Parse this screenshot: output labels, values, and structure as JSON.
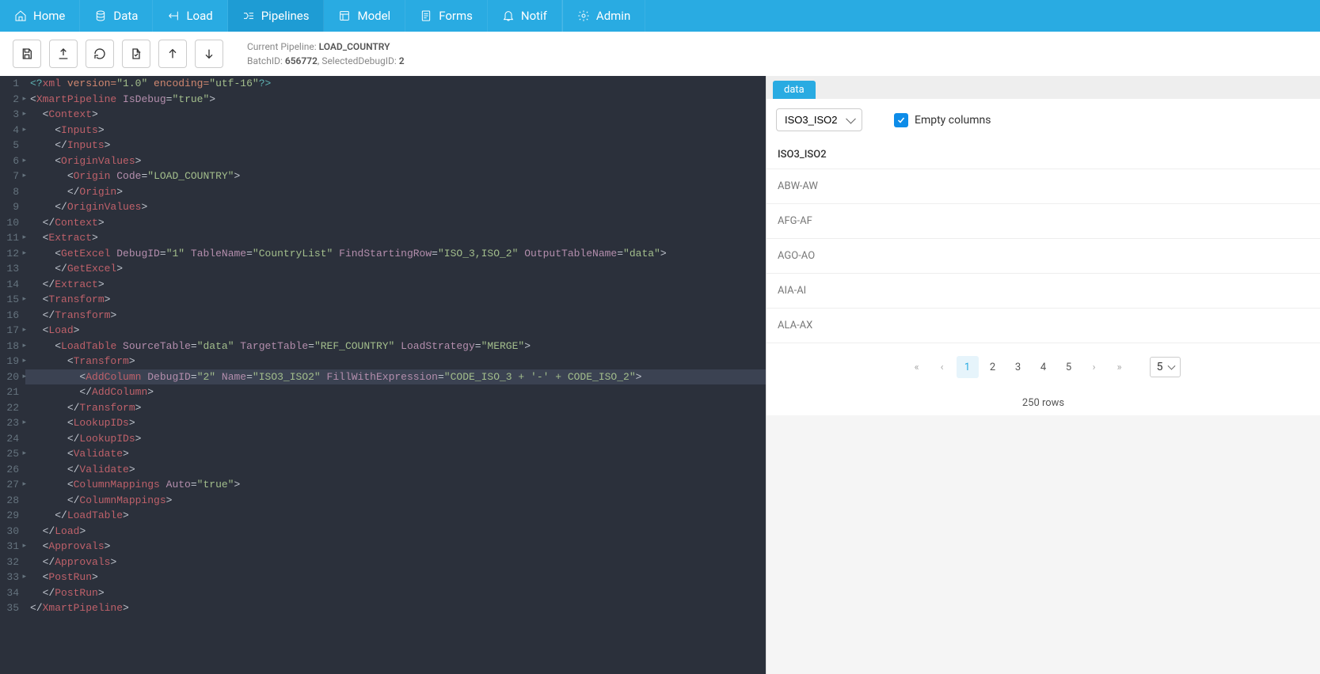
{
  "nav": [
    {
      "label": "Home",
      "icon": "home"
    },
    {
      "label": "Data",
      "icon": "db"
    },
    {
      "label": "Load",
      "icon": "load"
    },
    {
      "label": "Pipelines",
      "icon": "pipe",
      "active": true
    },
    {
      "label": "Model",
      "icon": "model"
    },
    {
      "label": "Forms",
      "icon": "forms"
    },
    {
      "label": "Notif",
      "icon": "bell"
    },
    {
      "label": "Admin",
      "icon": "gear",
      "sep": true
    }
  ],
  "info": {
    "pipeline_label": "Current Pipeline: ",
    "pipeline_name": "LOAD_COUNTRY",
    "batch_label": "BatchID: ",
    "batch_id": "656772",
    "debug_label": ", SelectedDebugID: ",
    "debug_id": "2"
  },
  "code": {
    "highlight_line": 20,
    "lines": [
      {
        "n": 1,
        "fold": false,
        "tokens": [
          [
            "<?",
            "pi"
          ],
          [
            "xml",
            "tag"
          ],
          [
            " version=",
            "attr"
          ],
          [
            "\"1.0\"",
            "str"
          ],
          [
            " encoding=",
            "attr"
          ],
          [
            "\"utf-16\"",
            "str"
          ],
          [
            "?>",
            "pi"
          ]
        ]
      },
      {
        "n": 2,
        "fold": true,
        "tokens": [
          [
            "<",
            "punct"
          ],
          [
            "XmartPipeline",
            "tag"
          ],
          [
            " IsDebug",
            "attr2"
          ],
          [
            "=",
            "punct"
          ],
          [
            "\"true\"",
            "str"
          ],
          [
            ">",
            "punct"
          ]
        ]
      },
      {
        "n": 3,
        "fold": true,
        "indent": 1,
        "tokens": [
          [
            "<",
            "punct"
          ],
          [
            "Context",
            "tag"
          ],
          [
            ">",
            "punct"
          ]
        ]
      },
      {
        "n": 4,
        "fold": true,
        "indent": 2,
        "tokens": [
          [
            "<",
            "punct"
          ],
          [
            "Inputs",
            "tag"
          ],
          [
            ">",
            "punct"
          ]
        ]
      },
      {
        "n": 5,
        "indent": 2,
        "tokens": [
          [
            "</",
            "punct"
          ],
          [
            "Inputs",
            "tag"
          ],
          [
            ">",
            "punct"
          ]
        ]
      },
      {
        "n": 6,
        "fold": true,
        "indent": 2,
        "tokens": [
          [
            "<",
            "punct"
          ],
          [
            "OriginValues",
            "tag"
          ],
          [
            ">",
            "punct"
          ]
        ]
      },
      {
        "n": 7,
        "fold": true,
        "indent": 3,
        "tokens": [
          [
            "<",
            "punct"
          ],
          [
            "Origin",
            "tag"
          ],
          [
            " Code",
            "attr2"
          ],
          [
            "=",
            "punct"
          ],
          [
            "\"LOAD_COUNTRY\"",
            "str"
          ],
          [
            ">",
            "punct"
          ]
        ]
      },
      {
        "n": 8,
        "indent": 3,
        "tokens": [
          [
            "</",
            "punct"
          ],
          [
            "Origin",
            "tag"
          ],
          [
            ">",
            "punct"
          ]
        ]
      },
      {
        "n": 9,
        "indent": 2,
        "tokens": [
          [
            "</",
            "punct"
          ],
          [
            "OriginValues",
            "tag"
          ],
          [
            ">",
            "punct"
          ]
        ]
      },
      {
        "n": 10,
        "indent": 1,
        "tokens": [
          [
            "</",
            "punct"
          ],
          [
            "Context",
            "tag"
          ],
          [
            ">",
            "punct"
          ]
        ]
      },
      {
        "n": 11,
        "fold": true,
        "indent": 1,
        "tokens": [
          [
            "<",
            "punct"
          ],
          [
            "Extract",
            "tag"
          ],
          [
            ">",
            "punct"
          ]
        ]
      },
      {
        "n": 12,
        "fold": true,
        "indent": 2,
        "tokens": [
          [
            "<",
            "punct"
          ],
          [
            "GetExcel",
            "tag"
          ],
          [
            " DebugID",
            "attr2"
          ],
          [
            "=",
            "punct"
          ],
          [
            "\"1\"",
            "str"
          ],
          [
            " TableName",
            "attr2"
          ],
          [
            "=",
            "punct"
          ],
          [
            "\"CountryList\"",
            "str"
          ],
          [
            " FindStartingRow",
            "attr2"
          ],
          [
            "=",
            "punct"
          ],
          [
            "\"ISO_3,ISO_2\"",
            "str"
          ],
          [
            " OutputTableName",
            "attr2"
          ],
          [
            "=",
            "punct"
          ],
          [
            "\"data\"",
            "str"
          ],
          [
            ">",
            "punct"
          ]
        ]
      },
      {
        "n": 13,
        "indent": 2,
        "tokens": [
          [
            "</",
            "punct"
          ],
          [
            "GetExcel",
            "tag"
          ],
          [
            ">",
            "punct"
          ]
        ]
      },
      {
        "n": 14,
        "indent": 1,
        "tokens": [
          [
            "</",
            "punct"
          ],
          [
            "Extract",
            "tag"
          ],
          [
            ">",
            "punct"
          ]
        ]
      },
      {
        "n": 15,
        "fold": true,
        "indent": 1,
        "tokens": [
          [
            "<",
            "punct"
          ],
          [
            "Transform",
            "tag"
          ],
          [
            ">",
            "punct"
          ]
        ]
      },
      {
        "n": 16,
        "indent": 1,
        "tokens": [
          [
            "</",
            "punct"
          ],
          [
            "Transform",
            "tag"
          ],
          [
            ">",
            "punct"
          ]
        ]
      },
      {
        "n": 17,
        "fold": true,
        "indent": 1,
        "tokens": [
          [
            "<",
            "punct"
          ],
          [
            "Load",
            "tag"
          ],
          [
            ">",
            "punct"
          ]
        ]
      },
      {
        "n": 18,
        "fold": true,
        "indent": 2,
        "tokens": [
          [
            "<",
            "punct"
          ],
          [
            "LoadTable",
            "tag"
          ],
          [
            " SourceTable",
            "attr2"
          ],
          [
            "=",
            "punct"
          ],
          [
            "\"data\"",
            "str"
          ],
          [
            " TargetTable",
            "attr2"
          ],
          [
            "=",
            "punct"
          ],
          [
            "\"REF_COUNTRY\"",
            "str"
          ],
          [
            " LoadStrategy",
            "attr2"
          ],
          [
            "=",
            "punct"
          ],
          [
            "\"MERGE\"",
            "str"
          ],
          [
            ">",
            "punct"
          ]
        ]
      },
      {
        "n": 19,
        "fold": true,
        "indent": 3,
        "tokens": [
          [
            "<",
            "punct"
          ],
          [
            "Transform",
            "tag"
          ],
          [
            ">",
            "punct"
          ]
        ]
      },
      {
        "n": 20,
        "fold": true,
        "indent": 4,
        "hl": true,
        "tokens": [
          [
            "<",
            "punct"
          ],
          [
            "AddColumn",
            "tag"
          ],
          [
            " DebugID",
            "attr2"
          ],
          [
            "=",
            "punct"
          ],
          [
            "\"2\"",
            "str"
          ],
          [
            " Name",
            "attr2"
          ],
          [
            "=",
            "punct"
          ],
          [
            "\"ISO3_ISO2\"",
            "str"
          ],
          [
            " FillWithExpression",
            "attr2"
          ],
          [
            "=",
            "punct"
          ],
          [
            "\"CODE_ISO_3 + '-' + CODE_ISO_2\"",
            "str"
          ],
          [
            ">",
            "punct"
          ]
        ]
      },
      {
        "n": 21,
        "indent": 4,
        "tokens": [
          [
            "</",
            "punct"
          ],
          [
            "AddColumn",
            "tag"
          ],
          [
            ">",
            "punct"
          ]
        ]
      },
      {
        "n": 22,
        "indent": 3,
        "tokens": [
          [
            "</",
            "punct"
          ],
          [
            "Transform",
            "tag"
          ],
          [
            ">",
            "punct"
          ]
        ]
      },
      {
        "n": 23,
        "fold": true,
        "indent": 3,
        "tokens": [
          [
            "<",
            "punct"
          ],
          [
            "LookupIDs",
            "tag"
          ],
          [
            ">",
            "punct"
          ]
        ]
      },
      {
        "n": 24,
        "indent": 3,
        "tokens": [
          [
            "</",
            "punct"
          ],
          [
            "LookupIDs",
            "tag"
          ],
          [
            ">",
            "punct"
          ]
        ]
      },
      {
        "n": 25,
        "fold": true,
        "indent": 3,
        "tokens": [
          [
            "<",
            "punct"
          ],
          [
            "Validate",
            "tag"
          ],
          [
            ">",
            "punct"
          ]
        ]
      },
      {
        "n": 26,
        "indent": 3,
        "tokens": [
          [
            "</",
            "punct"
          ],
          [
            "Validate",
            "tag"
          ],
          [
            ">",
            "punct"
          ]
        ]
      },
      {
        "n": 27,
        "fold": true,
        "indent": 3,
        "tokens": [
          [
            "<",
            "punct"
          ],
          [
            "ColumnMappings",
            "tag"
          ],
          [
            " Auto",
            "attr2"
          ],
          [
            "=",
            "punct"
          ],
          [
            "\"true\"",
            "str"
          ],
          [
            ">",
            "punct"
          ]
        ]
      },
      {
        "n": 28,
        "indent": 3,
        "tokens": [
          [
            "</",
            "punct"
          ],
          [
            "ColumnMappings",
            "tag"
          ],
          [
            ">",
            "punct"
          ]
        ]
      },
      {
        "n": 29,
        "indent": 2,
        "tokens": [
          [
            "</",
            "punct"
          ],
          [
            "LoadTable",
            "tag"
          ],
          [
            ">",
            "punct"
          ]
        ]
      },
      {
        "n": 30,
        "indent": 1,
        "tokens": [
          [
            "</",
            "punct"
          ],
          [
            "Load",
            "tag"
          ],
          [
            ">",
            "punct"
          ]
        ]
      },
      {
        "n": 31,
        "fold": true,
        "indent": 1,
        "tokens": [
          [
            "<",
            "punct"
          ],
          [
            "Approvals",
            "tag"
          ],
          [
            ">",
            "punct"
          ]
        ]
      },
      {
        "n": 32,
        "indent": 1,
        "tokens": [
          [
            "</",
            "punct"
          ],
          [
            "Approvals",
            "tag"
          ],
          [
            ">",
            "punct"
          ]
        ]
      },
      {
        "n": 33,
        "fold": true,
        "indent": 1,
        "tokens": [
          [
            "<",
            "punct"
          ],
          [
            "PostRun",
            "tag"
          ],
          [
            ">",
            "punct"
          ]
        ]
      },
      {
        "n": 34,
        "indent": 1,
        "tokens": [
          [
            "</",
            "punct"
          ],
          [
            "PostRun",
            "tag"
          ],
          [
            ">",
            "punct"
          ]
        ]
      },
      {
        "n": 35,
        "tokens": [
          [
            "</",
            "punct"
          ],
          [
            "XmartPipeline",
            "tag"
          ],
          [
            ">",
            "punct"
          ]
        ]
      }
    ]
  },
  "rpanel": {
    "tab": "data",
    "column_select": "ISO3_ISO2",
    "empty_cols_label": "Empty columns",
    "empty_cols_checked": true,
    "header": "ISO3_ISO2",
    "rows": [
      "ABW-AW",
      "AFG-AF",
      "AGO-AO",
      "AIA-AI",
      "ALA-AX"
    ],
    "pages": [
      "1",
      "2",
      "3",
      "4",
      "5"
    ],
    "active_page": "1",
    "page_size": "5",
    "row_count": "250 rows"
  }
}
